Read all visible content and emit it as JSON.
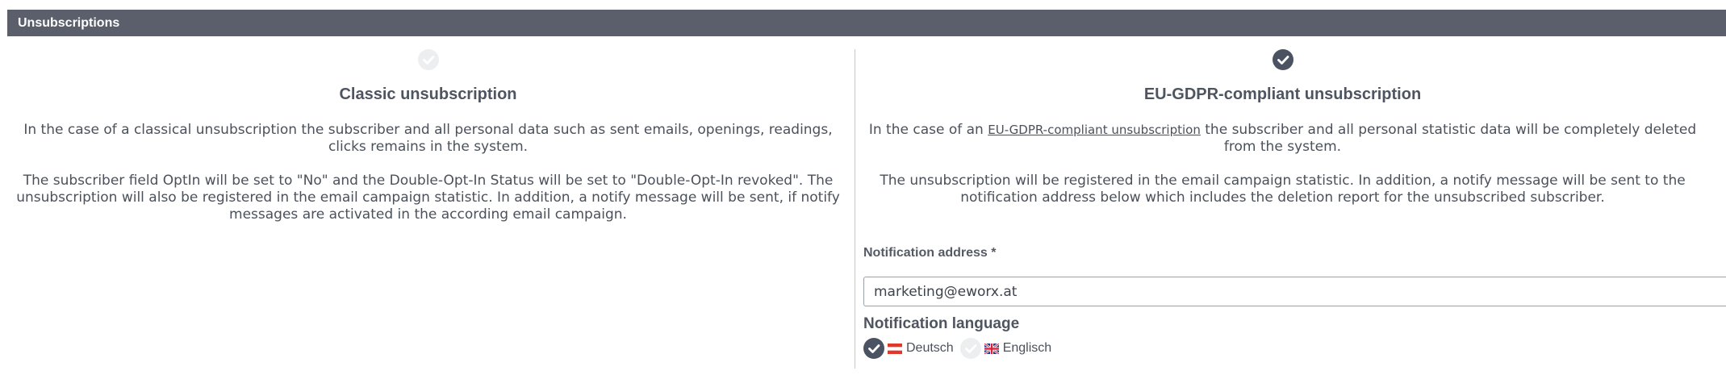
{
  "panel": {
    "title": "Unsubscriptions"
  },
  "classic": {
    "selected": false,
    "title": "Classic unsubscription",
    "paragraph1": "In the case of a classical unsubscription the subscriber and all personal data such as sent emails, openings, readings, clicks remains in the system.",
    "paragraph2": "The subscriber field OptIn will be set to \"No\" and the Double-Opt-In Status will be set to \"Double-Opt-In revoked\". The unsubscription will also be registered in the email campaign statistic. In addition, a notify message will be sent, if notify messages are activated in the according email campaign."
  },
  "gdpr": {
    "selected": true,
    "title": "EU-GDPR-compliant unsubscription",
    "paragraph1_prefix": "In the case of an",
    "paragraph1_link": "EU-GDPR-compliant unsubscription",
    "paragraph1_suffix": "the subscriber and all personal statistic data will be completely deleted from the system.",
    "paragraph2": "The unsubscription will be registered in the email campaign statistic. In addition, a notify message will be sent to the notification address below which includes the deletion report for the unsubscribed subscriber.",
    "notification_address_label": "Notification address *",
    "notification_address_value": "marketing@eworx.at",
    "notification_language_label": "Notification language",
    "languages": [
      {
        "label": "Deutsch",
        "flag": "austria-flag-icon",
        "selected": true
      },
      {
        "label": "Englisch",
        "flag": "uk-flag-icon",
        "selected": false
      }
    ]
  },
  "colors": {
    "header_bg": "#5a5f6b",
    "radio_selected": "#4b5261",
    "radio_unselected": "#eceeef"
  }
}
